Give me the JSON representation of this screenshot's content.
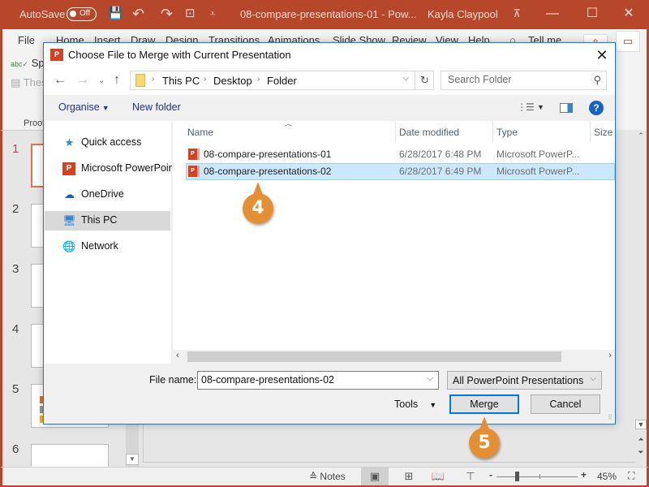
{
  "titlebar": {
    "autosave_label": "AutoSave",
    "autosave_state": "Off",
    "document_title": "08-compare-presentations-01  -  Pow...",
    "user_name": "Kayla Claypool",
    "icons": {
      "save": "💾",
      "undo": "↶",
      "redo": "↷",
      "present": "⊡",
      "customize": "⩡",
      "ribbon_display": "⊼",
      "minimize": "—",
      "maximize": "☐",
      "close": "✕"
    }
  },
  "ribbon": {
    "tabs": [
      "File",
      "Home",
      "Insert",
      "Draw",
      "Design",
      "Transitions",
      "Animations",
      "Slide Show",
      "Review",
      "View",
      "Help"
    ],
    "tell_me": "Tell me",
    "spelling": "Spel",
    "thesaurus": "Thes",
    "group_label": "Proof"
  },
  "slides_pane": {
    "slide_numbers": [
      "1",
      "2",
      "3",
      "4",
      "5",
      "6"
    ],
    "active_slide": "1"
  },
  "dialog": {
    "title": "Choose File to Merge with Current Presentation",
    "title_icon": "P",
    "address": {
      "breadcrumbs": [
        "This PC",
        "Desktop",
        "Folder"
      ]
    },
    "search_placeholder": "Search Folder",
    "toolbar": {
      "organise": "Organise",
      "new_folder": "New folder",
      "help": "?"
    },
    "nav": [
      {
        "label": "Quick access",
        "icon": "★",
        "selected": false
      },
      {
        "label": "Microsoft PowerPoint",
        "icon": "P",
        "selected": false
      },
      {
        "label": "OneDrive",
        "icon": "☁",
        "selected": false
      },
      {
        "label": "This PC",
        "icon": "🖥",
        "selected": true
      },
      {
        "label": "Network",
        "icon": "🌐",
        "selected": false
      }
    ],
    "columns": [
      "Name",
      "Date modified",
      "Type",
      "Size"
    ],
    "files": [
      {
        "name": "08-compare-presentations-01",
        "date": "6/28/2017 6:48 PM",
        "type": "Microsoft PowerP...",
        "size": "",
        "selected": false
      },
      {
        "name": "08-compare-presentations-02",
        "date": "6/28/2017 6:49 PM",
        "type": "Microsoft PowerP...",
        "size": "",
        "selected": true
      }
    ],
    "file_name_label": "File name:",
    "file_name_value": "08-compare-presentations-02",
    "file_type": "All PowerPoint Presentations",
    "tools_label": "Tools",
    "merge_label": "Merge",
    "cancel_label": "Cancel"
  },
  "callouts": {
    "step4": "4",
    "step5": "5"
  },
  "statusbar": {
    "notes_label": "Notes",
    "zoom_level": "45%",
    "zoom_minus": "-",
    "zoom_plus": "+"
  },
  "colors": {
    "accent": "#b7472a",
    "callout": "#e58f35",
    "selection": "#cce8ff",
    "focus": "#0078d7"
  }
}
